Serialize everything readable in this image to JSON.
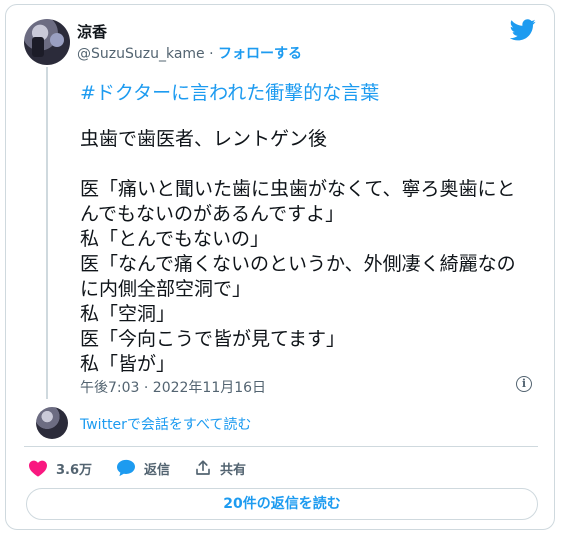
{
  "user": {
    "name": "涼香",
    "handle": "@SuzuSuzu_kame",
    "separator": "·",
    "follow_label": "フォローする"
  },
  "tweet": {
    "hashtag": "#ドクターに言われた衝撃的な言葉",
    "lines": [
      "虫歯で歯医者、レントゲン後",
      "",
      "医「痛いと聞いた歯に虫歯がなくて、寧ろ奥歯にと",
      "んでもないのがあるんですよ」",
      "私「とんでもないの」",
      "医「なんで痛くないのというか、外側凄く綺麗なの",
      "に内側全部空洞で」",
      "私「空洞」",
      "医「今向こうで皆が見てます」",
      "私「皆が」"
    ],
    "timestamp": "午後7:03 · 2022年11月16日"
  },
  "thread": {
    "read_conversation": "Twitterで会話をすべて読む"
  },
  "actions": {
    "likes": "3.6万",
    "reply_label": "返信",
    "share_label": "共有"
  },
  "replies_button": "20件の返信を読む",
  "colors": {
    "accent": "#1d9bf0",
    "like": "#f91880",
    "muted": "#536471",
    "border": "#cfd9de"
  },
  "icons": [
    "twitter-bird-icon",
    "info-icon",
    "heart-icon",
    "reply-bubble-icon",
    "share-icon"
  ]
}
